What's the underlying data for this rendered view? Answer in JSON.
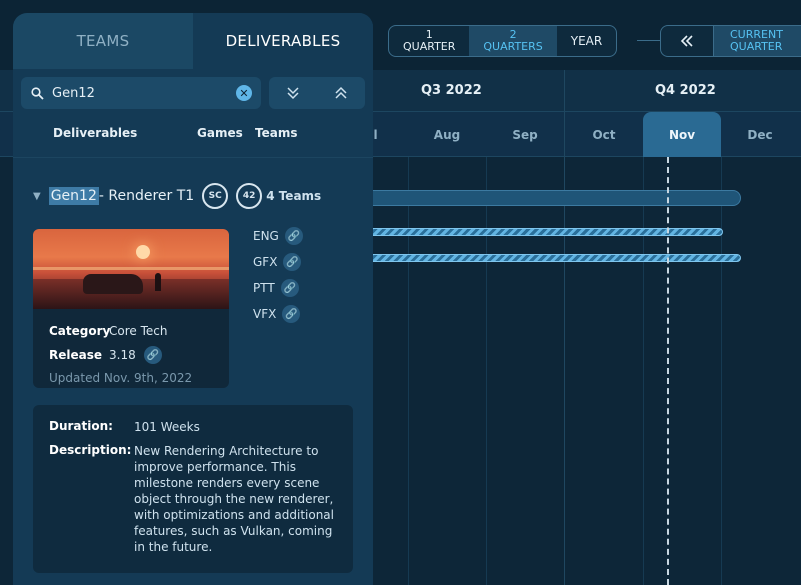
{
  "tabs": [
    {
      "label": "TEAMS",
      "active": false
    },
    {
      "label": "DELIVERABLES",
      "active": true
    }
  ],
  "search": {
    "value": "Gen12"
  },
  "columns": {
    "deliverables": "Deliverables",
    "games": "Games",
    "teams": "Teams"
  },
  "time_scale": {
    "options": [
      {
        "line1": "1",
        "line2": "QUARTER",
        "active": false
      },
      {
        "line1": "2",
        "line2": "QUARTERS",
        "active": true
      },
      {
        "line1": "YEAR",
        "line2": "",
        "active": false
      }
    ]
  },
  "navigation": {
    "prev_icon": "double-chevron-left-icon",
    "current_line1": "CURRENT",
    "current_line2": "QUARTER"
  },
  "timeline": {
    "quarters": [
      "Q3 2022",
      "Q4 2022"
    ],
    "months": [
      "Jul",
      "Aug",
      "Sep",
      "Oct",
      "Nov",
      "Dec"
    ],
    "current_month": "Nov"
  },
  "deliverable": {
    "title_highlight": "Gen12",
    "title_rest": " - Renderer T1",
    "games": [
      "Star Citizen",
      "Squadron 42"
    ],
    "game_logo_text": [
      "SC",
      "42"
    ],
    "teams_count": "4 Teams",
    "teams": [
      "ENG",
      "GFX",
      "PTT",
      "VFX"
    ],
    "category_label": "Category",
    "category": "Core Tech",
    "release_label": "Release",
    "release": "3.18",
    "updated": "Updated Nov. 9th, 2022",
    "duration_label": "Duration:",
    "duration": "101 Weeks",
    "description_label": "Description:",
    "description": "New Rendering Architecture to improve performance. This milestone renders every scene object through the new renderer, with optimizations and additional features, such as Vulkan, coming in the future."
  },
  "colors": {
    "accent": "#56c2f2",
    "panel": "#143a55",
    "background": "#0c2435"
  }
}
